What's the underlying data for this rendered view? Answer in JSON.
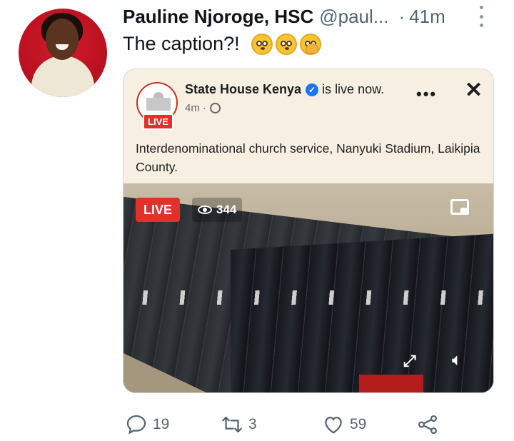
{
  "author": {
    "name": "Pauline Njoroge, HSC",
    "handle": "@paul...",
    "separator": "·",
    "time": "41m"
  },
  "tweet": {
    "text": "The caption?!",
    "emojis": [
      "flushed-face-emoji",
      "flushed-face-emoji",
      "face-with-hand-over-mouth-emoji"
    ]
  },
  "embedded_post": {
    "page_name": "State House Kenya",
    "status": "is live now.",
    "logo_badge": "LIVE",
    "time": "4m",
    "time_separator": "·",
    "text": "Interdenominational church service, Nanyuki Stadium, Laikipia County.",
    "video": {
      "live_label": "LIVE",
      "viewer_count": "344"
    }
  },
  "actions": {
    "replies": "19",
    "retweets": "3",
    "likes": "59"
  },
  "colors": {
    "live_red": "#e0322a",
    "verified_blue": "#1877f2",
    "secondary_text": "#536471",
    "card_background": "#f7f0e2"
  }
}
